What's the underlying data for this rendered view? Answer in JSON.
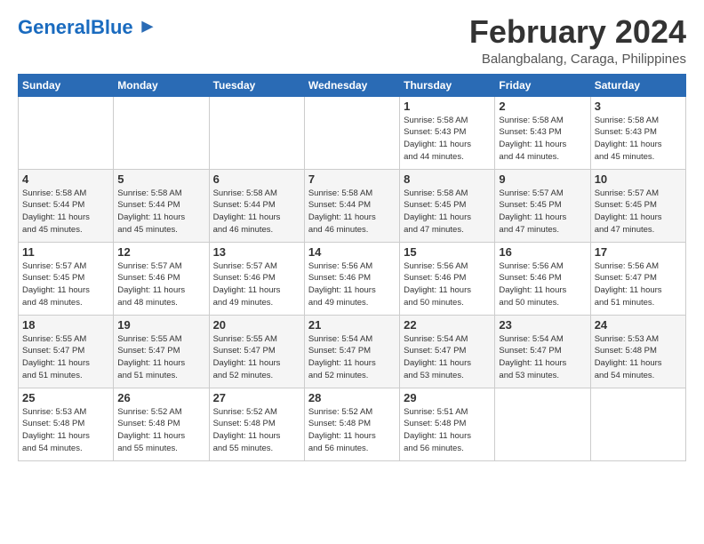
{
  "logo": {
    "text_general": "General",
    "text_blue": "Blue"
  },
  "header": {
    "title": "February 2024",
    "subtitle": "Balangbalang, Caraga, Philippines"
  },
  "weekdays": [
    "Sunday",
    "Monday",
    "Tuesday",
    "Wednesday",
    "Thursday",
    "Friday",
    "Saturday"
  ],
  "weeks": [
    [
      {
        "day": "",
        "info": ""
      },
      {
        "day": "",
        "info": ""
      },
      {
        "day": "",
        "info": ""
      },
      {
        "day": "",
        "info": ""
      },
      {
        "day": "1",
        "info": "Sunrise: 5:58 AM\nSunset: 5:43 PM\nDaylight: 11 hours\nand 44 minutes."
      },
      {
        "day": "2",
        "info": "Sunrise: 5:58 AM\nSunset: 5:43 PM\nDaylight: 11 hours\nand 44 minutes."
      },
      {
        "day": "3",
        "info": "Sunrise: 5:58 AM\nSunset: 5:43 PM\nDaylight: 11 hours\nand 45 minutes."
      }
    ],
    [
      {
        "day": "4",
        "info": "Sunrise: 5:58 AM\nSunset: 5:44 PM\nDaylight: 11 hours\nand 45 minutes."
      },
      {
        "day": "5",
        "info": "Sunrise: 5:58 AM\nSunset: 5:44 PM\nDaylight: 11 hours\nand 45 minutes."
      },
      {
        "day": "6",
        "info": "Sunrise: 5:58 AM\nSunset: 5:44 PM\nDaylight: 11 hours\nand 46 minutes."
      },
      {
        "day": "7",
        "info": "Sunrise: 5:58 AM\nSunset: 5:44 PM\nDaylight: 11 hours\nand 46 minutes."
      },
      {
        "day": "8",
        "info": "Sunrise: 5:58 AM\nSunset: 5:45 PM\nDaylight: 11 hours\nand 47 minutes."
      },
      {
        "day": "9",
        "info": "Sunrise: 5:57 AM\nSunset: 5:45 PM\nDaylight: 11 hours\nand 47 minutes."
      },
      {
        "day": "10",
        "info": "Sunrise: 5:57 AM\nSunset: 5:45 PM\nDaylight: 11 hours\nand 47 minutes."
      }
    ],
    [
      {
        "day": "11",
        "info": "Sunrise: 5:57 AM\nSunset: 5:45 PM\nDaylight: 11 hours\nand 48 minutes."
      },
      {
        "day": "12",
        "info": "Sunrise: 5:57 AM\nSunset: 5:46 PM\nDaylight: 11 hours\nand 48 minutes."
      },
      {
        "day": "13",
        "info": "Sunrise: 5:57 AM\nSunset: 5:46 PM\nDaylight: 11 hours\nand 49 minutes."
      },
      {
        "day": "14",
        "info": "Sunrise: 5:56 AM\nSunset: 5:46 PM\nDaylight: 11 hours\nand 49 minutes."
      },
      {
        "day": "15",
        "info": "Sunrise: 5:56 AM\nSunset: 5:46 PM\nDaylight: 11 hours\nand 50 minutes."
      },
      {
        "day": "16",
        "info": "Sunrise: 5:56 AM\nSunset: 5:46 PM\nDaylight: 11 hours\nand 50 minutes."
      },
      {
        "day": "17",
        "info": "Sunrise: 5:56 AM\nSunset: 5:47 PM\nDaylight: 11 hours\nand 51 minutes."
      }
    ],
    [
      {
        "day": "18",
        "info": "Sunrise: 5:55 AM\nSunset: 5:47 PM\nDaylight: 11 hours\nand 51 minutes."
      },
      {
        "day": "19",
        "info": "Sunrise: 5:55 AM\nSunset: 5:47 PM\nDaylight: 11 hours\nand 51 minutes."
      },
      {
        "day": "20",
        "info": "Sunrise: 5:55 AM\nSunset: 5:47 PM\nDaylight: 11 hours\nand 52 minutes."
      },
      {
        "day": "21",
        "info": "Sunrise: 5:54 AM\nSunset: 5:47 PM\nDaylight: 11 hours\nand 52 minutes."
      },
      {
        "day": "22",
        "info": "Sunrise: 5:54 AM\nSunset: 5:47 PM\nDaylight: 11 hours\nand 53 minutes."
      },
      {
        "day": "23",
        "info": "Sunrise: 5:54 AM\nSunset: 5:47 PM\nDaylight: 11 hours\nand 53 minutes."
      },
      {
        "day": "24",
        "info": "Sunrise: 5:53 AM\nSunset: 5:48 PM\nDaylight: 11 hours\nand 54 minutes."
      }
    ],
    [
      {
        "day": "25",
        "info": "Sunrise: 5:53 AM\nSunset: 5:48 PM\nDaylight: 11 hours\nand 54 minutes."
      },
      {
        "day": "26",
        "info": "Sunrise: 5:52 AM\nSunset: 5:48 PM\nDaylight: 11 hours\nand 55 minutes."
      },
      {
        "day": "27",
        "info": "Sunrise: 5:52 AM\nSunset: 5:48 PM\nDaylight: 11 hours\nand 55 minutes."
      },
      {
        "day": "28",
        "info": "Sunrise: 5:52 AM\nSunset: 5:48 PM\nDaylight: 11 hours\nand 56 minutes."
      },
      {
        "day": "29",
        "info": "Sunrise: 5:51 AM\nSunset: 5:48 PM\nDaylight: 11 hours\nand 56 minutes."
      },
      {
        "day": "",
        "info": ""
      },
      {
        "day": "",
        "info": ""
      }
    ]
  ]
}
